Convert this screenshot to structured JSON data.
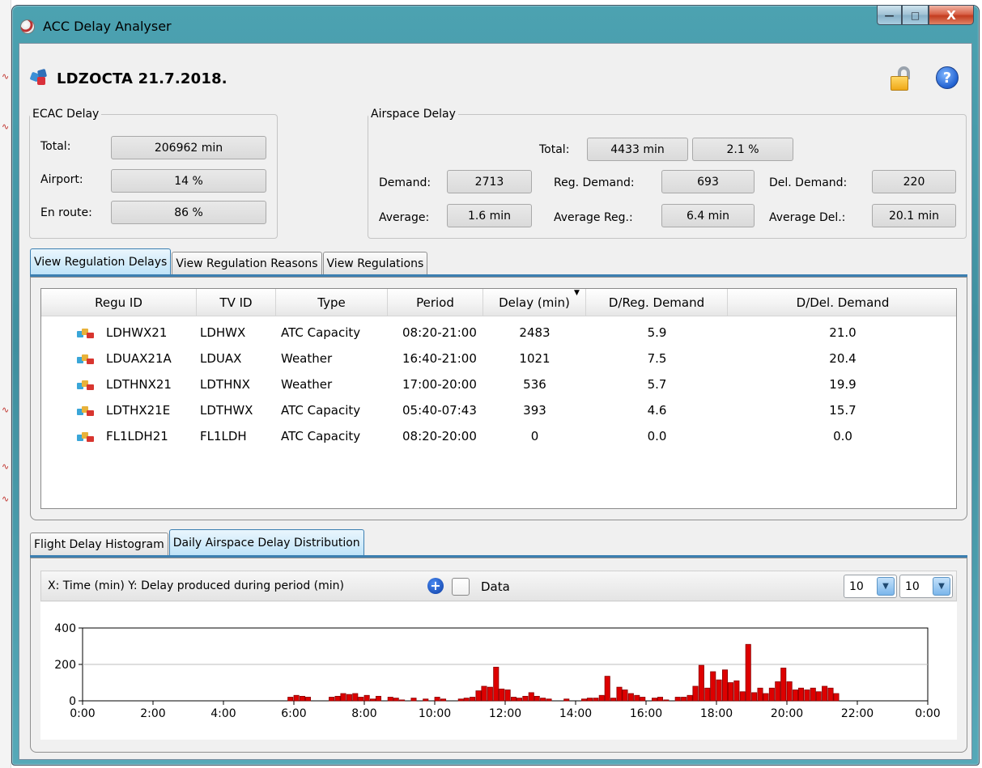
{
  "window": {
    "title": "ACC Delay Analyser",
    "minimize_glyph": "—",
    "maximize_glyph": "□",
    "close_glyph": "X"
  },
  "header": {
    "title": "LDZOCTA  21.7.2018.",
    "icons": [
      "airspace-icon",
      "lock-open-icon",
      "help-icon"
    ],
    "help_glyph": "?"
  },
  "ecac": {
    "legend": "ECAC Delay",
    "total_label": "Total:",
    "total_value": "206962 min",
    "airport_label": "Airport:",
    "airport_value": "14 %",
    "enroute_label": "En route:",
    "enroute_value": "86 %"
  },
  "airspace": {
    "legend": "Airspace Delay",
    "total_label": "Total:",
    "total_value": "4433 min",
    "total_percent": "2.1 %",
    "demand_label": "Demand:",
    "demand_value": "2713",
    "reg_demand_label": "Reg. Demand:",
    "reg_demand_value": "693",
    "del_demand_label": "Del. Demand:",
    "del_demand_value": "220",
    "average_label": "Average:",
    "average_value": "1.6 min",
    "average_reg_label": "Average Reg.:",
    "average_reg_value": "6.4 min",
    "average_del_label": "Average Del.:",
    "average_del_value": "20.1 min"
  },
  "top_tabs": [
    "View Regulation Delays",
    "View Regulation Reasons",
    "View Regulations"
  ],
  "table": {
    "columns": [
      "Regu ID",
      "TV ID",
      "Type",
      "Period",
      "Delay (min)",
      "D/Reg. Demand",
      "D/Del. Demand"
    ],
    "sort_glyph": "▼",
    "rows": [
      [
        "LDHWX21",
        "LDHWX",
        "ATC Capacity",
        "08:20-21:00",
        "2483",
        "5.9",
        "21.0"
      ],
      [
        "LDUAX21A",
        "LDUAX",
        "Weather",
        "16:40-21:00",
        "1021",
        "7.5",
        "20.4"
      ],
      [
        "LDTHNX21",
        "LDTHNX",
        "Weather",
        "17:00-20:00",
        "536",
        "5.7",
        "19.9"
      ],
      [
        "LDTHX21E",
        "LDTHWX",
        "ATC Capacity",
        "05:40-07:43",
        "393",
        "4.6",
        "15.7"
      ],
      [
        "FL1LDH21",
        "FL1LDH",
        "ATC Capacity",
        "08:20-20:00",
        "0",
        "0.0",
        "0.0"
      ]
    ]
  },
  "bottom_tabs": [
    "Flight Delay Histogram",
    "Daily Airspace Delay Distribution"
  ],
  "chart_toolbar": {
    "axes_text": "X: Time (min)  Y: Delay produced during period (min)",
    "data_label": "Data",
    "plus_glyph": "+",
    "combo1": "10",
    "combo2": "10",
    "combo_arrow": "▼"
  },
  "colors": {
    "bar_fill": "#dd0000",
    "bar_stroke": "#8a0000",
    "tab_active": "#bfe3f8",
    "title_bar": "#4ca2b1"
  },
  "chart_data": {
    "type": "bar",
    "x_unit": "hours (0:00-24:00)",
    "bin_minutes": 10,
    "xlim": [
      0,
      24
    ],
    "ylim": [
      0,
      400
    ],
    "yticks": [
      0,
      200,
      400
    ],
    "xtick_labels": [
      "0:00",
      "2:00",
      "4:00",
      "6:00",
      "8:00",
      "10:00",
      "12:00",
      "14:00",
      "16:00",
      "18:00",
      "20:00",
      "22:00",
      "0:00"
    ],
    "grid": "horizontal",
    "x": [
      5.83,
      6.0,
      6.17,
      6.33,
      7.0,
      7.17,
      7.33,
      7.5,
      7.67,
      7.83,
      8.0,
      8.17,
      8.33,
      8.67,
      8.83,
      9.0,
      9.33,
      9.67,
      10.0,
      10.17,
      10.67,
      10.83,
      11.0,
      11.17,
      11.33,
      11.5,
      11.67,
      11.83,
      12.0,
      12.17,
      12.33,
      12.5,
      12.67,
      12.83,
      13.0,
      13.17,
      13.67,
      14.17,
      14.33,
      14.5,
      14.67,
      14.83,
      15.0,
      15.17,
      15.33,
      15.5,
      15.67,
      15.83,
      16.17,
      16.33,
      16.5,
      16.83,
      17.0,
      17.17,
      17.33,
      17.5,
      17.67,
      17.83,
      18.0,
      18.17,
      18.33,
      18.5,
      18.67,
      18.83,
      19.0,
      19.17,
      19.33,
      19.5,
      19.67,
      19.83,
      20.0,
      20.17,
      20.33,
      20.5,
      20.67,
      20.83,
      21.0,
      21.17,
      21.33
    ],
    "values": [
      20,
      30,
      25,
      20,
      20,
      25,
      40,
      35,
      40,
      20,
      30,
      10,
      25,
      20,
      15,
      5,
      15,
      10,
      20,
      10,
      10,
      15,
      20,
      55,
      80,
      75,
      185,
      65,
      60,
      20,
      15,
      25,
      45,
      25,
      15,
      10,
      10,
      10,
      15,
      15,
      30,
      135,
      15,
      75,
      60,
      40,
      30,
      20,
      15,
      20,
      5,
      20,
      20,
      30,
      80,
      195,
      70,
      160,
      115,
      170,
      100,
      110,
      50,
      310,
      45,
      70,
      40,
      70,
      105,
      180,
      105,
      60,
      70,
      60,
      70,
      50,
      80,
      70,
      40
    ]
  }
}
